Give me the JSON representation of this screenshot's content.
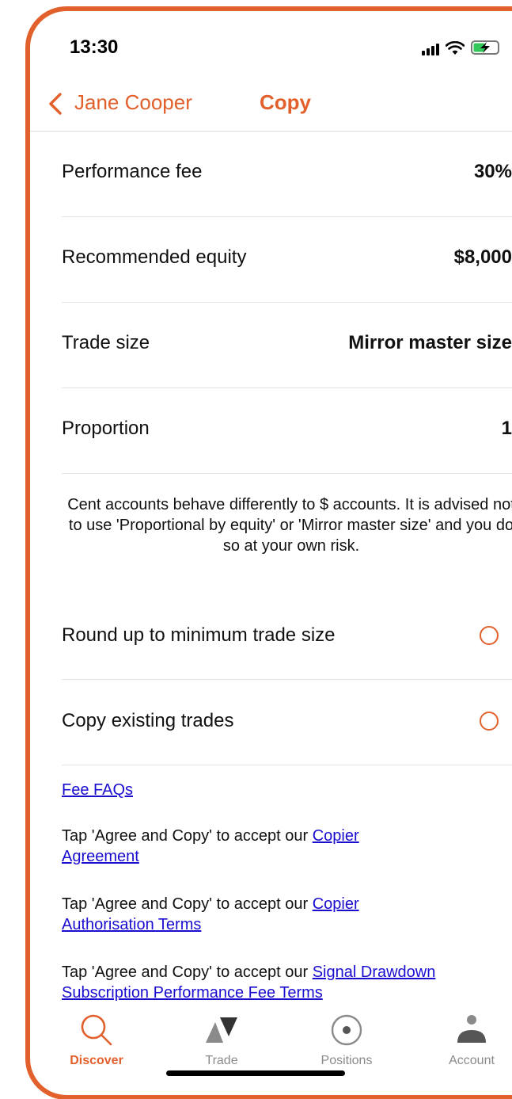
{
  "status_bar": {
    "time": "13:30"
  },
  "nav": {
    "back_label": "Jane Cooper",
    "title": "Copy"
  },
  "settings": [
    {
      "label": "Performance fee",
      "value": "30%"
    },
    {
      "label": "Recommended equity",
      "value": "$8,000"
    },
    {
      "label": "Trade size",
      "value": "Mirror master size"
    },
    {
      "label": "Proportion",
      "value": "1"
    }
  ],
  "notice": "Cent accounts behave differently to $ accounts. It is advised not to use 'Proportional by equity' or 'Mirror master size' and you do so at your own risk.",
  "toggles": [
    {
      "label": "Round up to minimum trade size",
      "checked": false
    },
    {
      "label": "Copy existing trades",
      "checked": false
    }
  ],
  "links": {
    "fee_faqs": "Fee FAQs",
    "prefix": "Tap 'Agree and Copy' to accept our ",
    "copier_agreement_1": "Copier",
    "copier_agreement_2": "Agreement",
    "authorisation_1": "Copier",
    "authorisation_2": "Authorisation Terms",
    "drawdown_1": "Signal Drawdown",
    "drawdown_2": "Subscription Performance Fee Terms"
  },
  "tabs": [
    {
      "label": "Discover",
      "icon": "search-icon",
      "active": true
    },
    {
      "label": "Trade",
      "icon": "trade-icon",
      "active": false
    },
    {
      "label": "Positions",
      "icon": "positions-icon",
      "active": false
    },
    {
      "label": "Account",
      "icon": "account-icon",
      "active": false
    }
  ],
  "colors": {
    "accent": "#e2602b",
    "link": "#1a0dcf",
    "inactive": "#8a8a8a"
  }
}
